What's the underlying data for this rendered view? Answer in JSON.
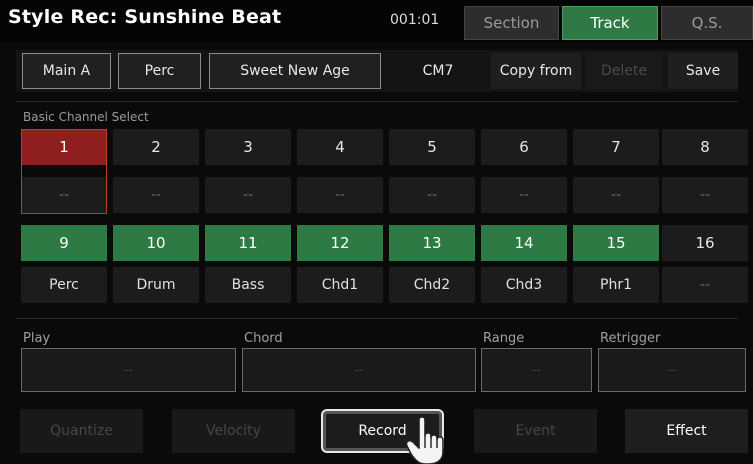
{
  "header": {
    "title": "Style Rec: Sunshine Beat",
    "position": "001:01",
    "tabs": [
      "Section",
      "Track",
      "Q.S."
    ],
    "active_tab": "Track"
  },
  "toolbar": {
    "section": "Main A",
    "track": "Perc",
    "voice": "Sweet New Age",
    "chord": "CM7",
    "copy_from": "Copy from",
    "delete": "Delete",
    "save": "Save"
  },
  "channels": {
    "label": "Basic Channel Select",
    "row1": [
      {
        "num": "1",
        "label": "--"
      },
      {
        "num": "2",
        "label": "--"
      },
      {
        "num": "3",
        "label": "--"
      },
      {
        "num": "4",
        "label": "--"
      },
      {
        "num": "5",
        "label": "--"
      },
      {
        "num": "6",
        "label": "--"
      },
      {
        "num": "7",
        "label": "--"
      },
      {
        "num": "8",
        "label": "--"
      }
    ],
    "row2": [
      {
        "num": "9",
        "label": "Perc"
      },
      {
        "num": "10",
        "label": "Drum"
      },
      {
        "num": "11",
        "label": "Bass"
      },
      {
        "num": "12",
        "label": "Chd1"
      },
      {
        "num": "13",
        "label": "Chd2"
      },
      {
        "num": "14",
        "label": "Chd3"
      },
      {
        "num": "15",
        "label": "Phr1"
      },
      {
        "num": "16",
        "label": "--"
      }
    ]
  },
  "params": {
    "play": {
      "label": "Play",
      "value": "--"
    },
    "chord": {
      "label": "Chord",
      "value": "--"
    },
    "range": {
      "label": "Range",
      "value": "--"
    },
    "retrigger": {
      "label": "Retrigger",
      "value": "--"
    }
  },
  "bottom": {
    "quantize": "Quantize",
    "velocity": "Velocity",
    "record": "Record",
    "event": "Event",
    "effect": "Effect"
  },
  "colors": {
    "active_tab": "#2f7a44",
    "selected_channel": "#8f1e1e",
    "assigned_channel": "#2e7a45"
  },
  "icons": {
    "pointer": "hand-pointer-icon"
  }
}
